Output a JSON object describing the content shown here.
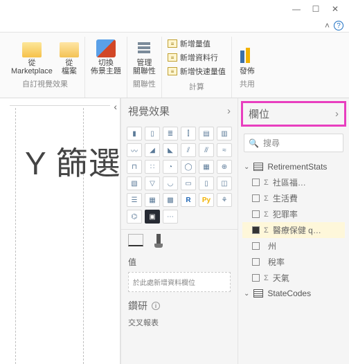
{
  "window": {
    "minimize": "—",
    "maximize": "☐",
    "close": "✕",
    "expand_up": "˄",
    "help": "?"
  },
  "ribbon": {
    "marketplace": {
      "from": "從",
      "label": "Marketplace"
    },
    "file": {
      "from": "從",
      "label": "檔案"
    },
    "theme": {
      "switch": "切換",
      "label": "佈景主題"
    },
    "group_custom_viz": "自訂視覺效果",
    "manage": {
      "l1": "管理",
      "l2": "關聯性"
    },
    "group_rel": "關聯性",
    "new_measure": "新增量值",
    "new_column": "新增資料行",
    "new_quick": "新增快速量值",
    "group_calc": "計算",
    "publish": "發佈",
    "group_share": "共用"
  },
  "canvas": {
    "collapse": "‹",
    "watermark": "Y 篩選"
  },
  "viz": {
    "title": "視覺效果",
    "r_label": "R",
    "py_label": "Py",
    "ellipsis": "⋯",
    "values_label": "值",
    "values_placeholder": "於此處新增資料欄位",
    "drill": "鑽研",
    "crossreport": "交叉報表"
  },
  "fields": {
    "title": "欄位",
    "search_placeholder": "搜尋",
    "tables": [
      {
        "name": "RetirementStats",
        "expanded": true,
        "items": [
          {
            "checked": false,
            "type": "Σ",
            "label": "社區福…"
          },
          {
            "checked": false,
            "type": "Σ",
            "label": "生活費"
          },
          {
            "checked": false,
            "type": "Σ",
            "label": "犯罪率"
          },
          {
            "checked": true,
            "type": "Σ",
            "label": "醫療保健 q…"
          },
          {
            "checked": false,
            "type": "",
            "label": "州"
          },
          {
            "checked": false,
            "type": "",
            "label": "稅率"
          },
          {
            "checked": false,
            "type": "Σ",
            "label": "天氣"
          }
        ]
      },
      {
        "name": "StateCodes",
        "expanded": false,
        "items": []
      }
    ]
  }
}
